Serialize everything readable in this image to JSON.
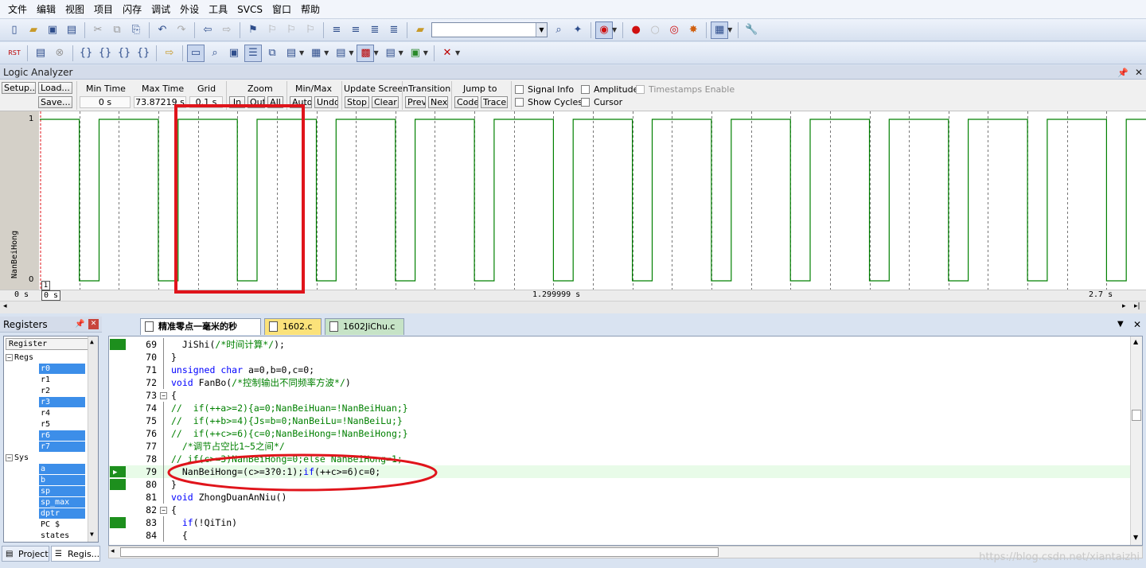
{
  "menu": [
    "文件",
    "编辑",
    "视图",
    "项目",
    "闪存",
    "调试",
    "外设",
    "工具",
    "SVCS",
    "窗口",
    "帮助"
  ],
  "colors": {
    "wave": "#008000",
    "annotation": "#e0141b",
    "selection": "#3c8ee9",
    "breakpoint": "#1d8f1d"
  },
  "logic_analyzer": {
    "title": "Logic Analyzer",
    "buttons": {
      "setup": "Setup...",
      "load": "Load...",
      "save": "Save..."
    },
    "min_time": {
      "label": "Min Time",
      "value": "0 s"
    },
    "max_time": {
      "label": "Max Time",
      "value": "73.87219 s"
    },
    "grid": {
      "label": "Grid",
      "value": "0.1 s"
    },
    "zoom": {
      "label": "Zoom",
      "in": "In",
      "out": "Out",
      "all": "All"
    },
    "minmax": {
      "label": "Min/Max",
      "auto": "Auto",
      "undo": "Undo"
    },
    "update": {
      "label": "Update Screen",
      "stop": "Stop",
      "clear": "Clear"
    },
    "transition": {
      "label": "Transition",
      "prev": "Prev",
      "next": "Next"
    },
    "jump": {
      "label": "Jump to",
      "code": "Code",
      "trace": "Trace"
    },
    "checks": {
      "signal_info": "Signal Info",
      "show_cycles": "Show Cycles",
      "amplitude": "Amplitude",
      "cursor": "Cursor",
      "timestamps": "Timestamps Enable"
    },
    "signal": {
      "name": "NanBeiHong",
      "high": "1",
      "low": "0"
    },
    "axis": {
      "start": "0 s",
      "cursor_left": "0 s",
      "mid": "1.299999 s",
      "end": "2.7 s",
      "marker": "1"
    },
    "wave_period_s": 0.2,
    "duty_high": 0.75,
    "visible_s": 2.8
  },
  "registers": {
    "title": "Registers",
    "header": "Register",
    "groups": [
      {
        "name": "Regs",
        "items": [
          {
            "name": "r0",
            "sel": true
          },
          {
            "name": "r1",
            "sel": false
          },
          {
            "name": "r2",
            "sel": false
          },
          {
            "name": "r3",
            "sel": true
          },
          {
            "name": "r4",
            "sel": false
          },
          {
            "name": "r5",
            "sel": false
          },
          {
            "name": "r6",
            "sel": true
          },
          {
            "name": "r7",
            "sel": true
          }
        ]
      },
      {
        "name": "Sys",
        "items": [
          {
            "name": "a",
            "sel": true
          },
          {
            "name": "b",
            "sel": true
          },
          {
            "name": "sp",
            "sel": true
          },
          {
            "name": "sp_max",
            "sel": true
          },
          {
            "name": "dptr",
            "sel": true
          },
          {
            "name": "PC  $",
            "sel": false
          },
          {
            "name": "states",
            "sel": false
          }
        ]
      }
    ],
    "tabs": {
      "project": "Project",
      "regs": "Regis..."
    }
  },
  "editor": {
    "tabs": [
      {
        "label": "精准零点一毫米的秒表.c",
        "active": true
      },
      {
        "label": "1602.c",
        "active": false
      },
      {
        "label": "1602JiChu.c",
        "active": false
      }
    ],
    "lines": [
      {
        "n": "69",
        "code": "  JiShi(/*时间计算*/);"
      },
      {
        "n": "70",
        "code": "}"
      },
      {
        "n": "71",
        "code": "unsigned char a=0,b=0,c=0;"
      },
      {
        "n": "72",
        "code": "void FanBo(/*控制输出不同频率方波*/)"
      },
      {
        "n": "73",
        "code": "{"
      },
      {
        "n": "74",
        "code": "//  if(++a>=2){a=0;NanBeiHuan=!NanBeiHuan;}"
      },
      {
        "n": "75",
        "code": "//  if(++b>=4){Js=b=0;NanBeiLu=!NanBeiLu;}"
      },
      {
        "n": "76",
        "code": "//  if(++c>=6){c=0;NanBeiHong=!NanBeiHong;}"
      },
      {
        "n": "77",
        "code": "  /*调节占空比1~5之间*/"
      },
      {
        "n": "78",
        "code": "// if(c>=3)NanBeiHong=0;else NanBeiHong=1;"
      },
      {
        "n": "79",
        "code": "  NanBeiHong=(c>=3?0:1);if(++c>=6)c=0;"
      },
      {
        "n": "80",
        "code": "}"
      },
      {
        "n": "81",
        "code": "void ZhongDuanAnNiu()"
      },
      {
        "n": "82",
        "code": "{"
      },
      {
        "n": "83",
        "code": "  if(!QiTin)"
      },
      {
        "n": "84",
        "code": "  {"
      }
    ],
    "watermark": "https://blog.csdn.net/xiantaizhi"
  }
}
